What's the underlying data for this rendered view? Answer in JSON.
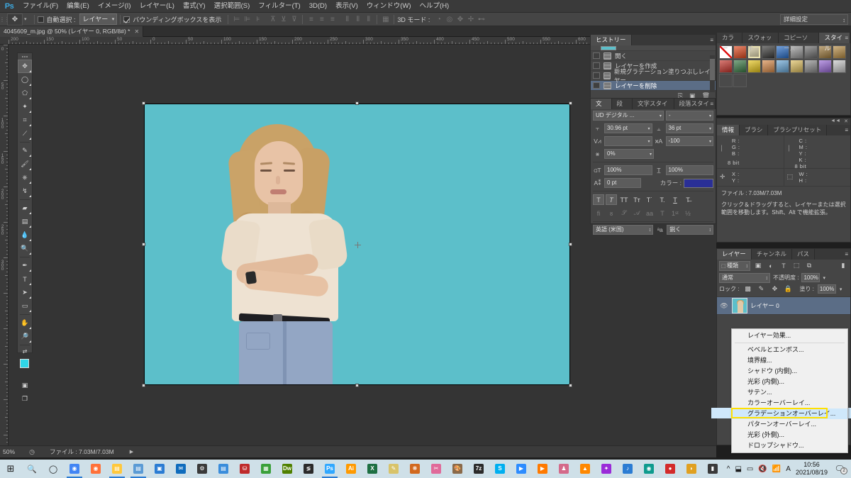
{
  "app": {
    "name": "Adobe Photoshop",
    "logo": "Ps"
  },
  "menubar": {
    "items": [
      {
        "label": "ファイル(F)",
        "name": "menu-file"
      },
      {
        "label": "編集(E)",
        "name": "menu-edit"
      },
      {
        "label": "イメージ(I)",
        "name": "menu-image"
      },
      {
        "label": "レイヤー(L)",
        "name": "menu-layer"
      },
      {
        "label": "書式(Y)",
        "name": "menu-type"
      },
      {
        "label": "選択範囲(S)",
        "name": "menu-select"
      },
      {
        "label": "フィルター(T)",
        "name": "menu-filter"
      },
      {
        "label": "3D(D)",
        "name": "menu-3d"
      },
      {
        "label": "表示(V)",
        "name": "menu-view"
      },
      {
        "label": "ウィンドウ(W)",
        "name": "menu-window"
      },
      {
        "label": "ヘルプ(H)",
        "name": "menu-help"
      }
    ]
  },
  "options_bar": {
    "tool_icon": "move-tool",
    "auto_select_label": "自動選択 :",
    "auto_select_checked": false,
    "auto_select_value": "レイヤー",
    "bounding_box_label": "バウンディングボックスを表示",
    "bounding_box_checked": true,
    "mode_3d_label": "3D モード :",
    "advanced_label": "詳細設定"
  },
  "document": {
    "tab_title": "4045609_m.jpg @ 50% (レイヤー 0, RGB/8#) *",
    "zoom": "50%",
    "file_size": "ファイル : 7.03M/7.03M",
    "background_color": "#5cbfca"
  },
  "rulers": {
    "h_labels": [
      "200",
      "150",
      "100",
      "50",
      "0",
      "50",
      "100",
      "150",
      "200",
      "250",
      "300",
      "350",
      "400",
      "450",
      "500",
      "550",
      "600",
      "650",
      "70"
    ],
    "v_labels": [
      "0",
      "50",
      "100",
      "150",
      "200",
      "250",
      "300"
    ]
  },
  "toolbar": {
    "tools": [
      {
        "name": "move-tool",
        "glyph": "✥",
        "selected": true
      },
      {
        "name": "marquee-tool",
        "glyph": "◯",
        "selected": false
      },
      {
        "name": "lasso-tool",
        "glyph": "⬠",
        "selected": false
      },
      {
        "name": "magic-wand-tool",
        "glyph": "✦",
        "selected": false
      },
      {
        "name": "crop-tool",
        "glyph": "⌗",
        "selected": false
      },
      {
        "name": "eyedropper-tool",
        "glyph": "⟋",
        "selected": false
      },
      {
        "name": "healing-brush-tool",
        "glyph": "✎",
        "selected": false
      },
      {
        "name": "brush-tool",
        "glyph": "🖌",
        "selected": false
      },
      {
        "name": "clone-stamp-tool",
        "glyph": "⎈",
        "selected": false
      },
      {
        "name": "history-brush-tool",
        "glyph": "↯",
        "selected": false
      },
      {
        "name": "eraser-tool",
        "glyph": "▰",
        "selected": false
      },
      {
        "name": "gradient-tool",
        "glyph": "▤",
        "selected": false
      },
      {
        "name": "blur-tool",
        "glyph": "💧",
        "selected": false
      },
      {
        "name": "dodge-tool",
        "glyph": "🔍",
        "selected": false
      },
      {
        "name": "pen-tool",
        "glyph": "✒",
        "selected": false
      },
      {
        "name": "type-tool",
        "glyph": "T",
        "selected": false
      },
      {
        "name": "path-selection-tool",
        "glyph": "➤",
        "selected": false
      },
      {
        "name": "shape-tool",
        "glyph": "▭",
        "selected": false
      },
      {
        "name": "hand-tool",
        "glyph": "✋",
        "selected": false
      },
      {
        "name": "zoom-tool",
        "glyph": "🔎",
        "selected": false
      }
    ],
    "foreground_color": "#2ed6e8",
    "background_color": "#ffffff"
  },
  "history_panel": {
    "tabs": [
      {
        "label": "ヒストリー",
        "active": true
      }
    ],
    "items": [
      {
        "label": "開く",
        "selected": false
      },
      {
        "label": "レイヤーを作成",
        "selected": false
      },
      {
        "label": "新規グラデーション塗りつぶしレイヤー",
        "selected": false
      },
      {
        "label": "レイヤーを削除",
        "selected": true
      }
    ]
  },
  "character_panel": {
    "tabs": [
      {
        "label": "文字",
        "active": true
      },
      {
        "label": "段落",
        "active": false
      },
      {
        "label": "文字スタイル",
        "active": false
      },
      {
        "label": "段落スタイル",
        "active": false
      }
    ],
    "font_family": "UD デジタル ...",
    "font_style": "-",
    "font_size": "30.96 pt",
    "leading": "36 pt",
    "kerning": "",
    "tracking": "-100",
    "vertical_scale_pct": "0%",
    "scale_v": "100%",
    "scale_h": "100%",
    "baseline_shift": "0 pt",
    "color_label": "カラー :",
    "color_value": "#2a2f96",
    "language": "英語 (米国)",
    "anti_alias": "鋭く"
  },
  "styles_panel": {
    "tabs": [
      {
        "label": "カラー",
        "active": false
      },
      {
        "label": "スウォッチ",
        "active": false
      },
      {
        "label": "コピーソース",
        "active": false
      },
      {
        "label": "スタイル",
        "active": true
      }
    ],
    "swatches": [
      "none",
      "#e24a1f",
      "#d9cfa6",
      "#3a3a38",
      "#2a6fc9",
      "#9a9a9a",
      "#6e6e6e",
      "#a07c3f",
      "#b98e45",
      "#c6342b",
      "#3a7a45",
      "#e8c61a",
      "#d98b4a",
      "#6aa8d8",
      "#e0c060",
      "#8e8e8e",
      "#9a6ad8",
      "#c9c9c9",
      "#4a4a4a",
      "#4a4a4a"
    ]
  },
  "info_panel": {
    "tabs": [
      {
        "label": "情報",
        "active": true
      },
      {
        "label": "ブラシ",
        "active": false
      },
      {
        "label": "ブラシプリセット",
        "active": false
      }
    ],
    "rgb": [
      "R :",
      "G :",
      "B :"
    ],
    "cmyk": [
      "C :",
      "M :",
      "Y :",
      "K :"
    ],
    "bit_left": "8 bit",
    "bit_right": "8 bit",
    "coords": [
      "X :",
      "Y :"
    ],
    "dims": [
      "W :",
      "H :"
    ],
    "file_line": "ファイル : 7.03M/7.03M",
    "hint": "クリック＆ドラッグすると、レイヤーまたは選択範囲を移動します。Shift、Alt で機能拡張。"
  },
  "layers_panel": {
    "tabs": [
      {
        "label": "レイヤー",
        "active": true
      },
      {
        "label": "チャンネル",
        "active": false
      },
      {
        "label": "パス",
        "active": false
      }
    ],
    "kind_label": "種類",
    "blend_mode": "通常",
    "opacity_label": "不透明度 :",
    "opacity_value": "100%",
    "lock_label": "ロック :",
    "fill_label": "塗り :",
    "fill_value": "100%",
    "layers": [
      {
        "name": "レイヤー 0",
        "visible": true,
        "selected": true
      }
    ]
  },
  "context_menu": {
    "items": [
      {
        "label": "レイヤー効果...",
        "selected": false,
        "separator_after": true
      },
      {
        "label": "ベベルとエンボス...",
        "selected": false
      },
      {
        "label": "境界線...",
        "selected": false
      },
      {
        "label": "シャドウ (内側)...",
        "selected": false
      },
      {
        "label": "光彩 (内側)...",
        "selected": false
      },
      {
        "label": "サテン...",
        "selected": false
      },
      {
        "label": "カラーオーバーレイ...",
        "selected": false
      },
      {
        "label": "グラデーションオーバーレイ...",
        "selected": true
      },
      {
        "label": "パターンオーバーレイ...",
        "selected": false
      },
      {
        "label": "光彩 (外側)...",
        "selected": false
      },
      {
        "label": "ドロップシャドウ...",
        "selected": false
      }
    ],
    "highlight_color": "#ffe000"
  },
  "taskbar": {
    "start": "⊞",
    "search": "search-icon",
    "cortana": "circle-icon",
    "apps": [
      {
        "name": "chrome",
        "glyph": "◉",
        "color": "#4285f4",
        "active": true
      },
      {
        "name": "firefox",
        "glyph": "◉",
        "color": "#ff7139",
        "active": false
      },
      {
        "name": "file-explorer",
        "glyph": "▤",
        "color": "#ffc83d",
        "active": true
      },
      {
        "name": "notes",
        "glyph": "▤",
        "color": "#5b9bd5",
        "active": true
      },
      {
        "name": "photos",
        "glyph": "▣",
        "color": "#2b7cd3",
        "active": false
      },
      {
        "name": "outlook",
        "glyph": "✉",
        "color": "#0f6cbd",
        "active": false
      },
      {
        "name": "settings",
        "glyph": "⚙",
        "color": "#3a3a3a",
        "active": false
      },
      {
        "name": "contacts",
        "glyph": "▤",
        "color": "#3a8ddb",
        "active": false
      },
      {
        "name": "filezilla",
        "glyph": "⛁",
        "color": "#bf2b2b",
        "active": false
      },
      {
        "name": "app-green",
        "glyph": "▦",
        "color": "#3aa03a",
        "active": false
      },
      {
        "name": "dreamweaver",
        "glyph": "Dw",
        "color": "#4f8000",
        "active": false
      },
      {
        "name": "sublime",
        "glyph": "≶",
        "color": "#2b2b2b",
        "active": false
      },
      {
        "name": "photoshop",
        "glyph": "Ps",
        "color": "#31a8ff",
        "active": true
      },
      {
        "name": "illustrator",
        "glyph": "Ai",
        "color": "#ff9a00",
        "active": false
      },
      {
        "name": "excel",
        "glyph": "X",
        "color": "#1d6f42",
        "active": false
      },
      {
        "name": "notepad",
        "glyph": "✎",
        "color": "#d8c36a",
        "active": false
      },
      {
        "name": "butterfly",
        "glyph": "❋",
        "color": "#d2691e",
        "active": false
      },
      {
        "name": "scissors",
        "glyph": "✂",
        "color": "#e06a9a",
        "active": false
      },
      {
        "name": "paint",
        "glyph": "🎨",
        "color": "#8a6a4a",
        "active": false
      },
      {
        "name": "7zip",
        "glyph": "7z",
        "color": "#2b2b2b",
        "active": false
      },
      {
        "name": "skype",
        "glyph": "S",
        "color": "#00aff0",
        "active": false
      },
      {
        "name": "zoom",
        "glyph": "▶",
        "color": "#2d8cff",
        "active": false
      },
      {
        "name": "media-player",
        "glyph": "▶",
        "color": "#ff7a00",
        "active": false
      },
      {
        "name": "app-pink",
        "glyph": "♟",
        "color": "#d46a8a",
        "active": false
      },
      {
        "name": "vlc",
        "glyph": "▲",
        "color": "#ff8800",
        "active": false
      },
      {
        "name": "purple-app",
        "glyph": "✦",
        "color": "#9a2bd8",
        "active": false
      },
      {
        "name": "music",
        "glyph": "♪",
        "color": "#2b7cd3",
        "active": false
      },
      {
        "name": "teal-app",
        "glyph": "◉",
        "color": "#0f9b8e",
        "active": false
      },
      {
        "name": "record",
        "glyph": "●",
        "color": "#d32b2b",
        "active": false
      },
      {
        "name": "honey-app",
        "glyph": "◗",
        "color": "#e0a020",
        "active": false
      },
      {
        "name": "sticky-notes",
        "glyph": "▮",
        "color": "#3a3a3a",
        "active": false
      }
    ],
    "tray": [
      "^",
      "⬓",
      "▭",
      "🔇",
      "📶",
      "A"
    ],
    "time": "10:56",
    "date": "2021/08/19",
    "notification_count": "2"
  }
}
